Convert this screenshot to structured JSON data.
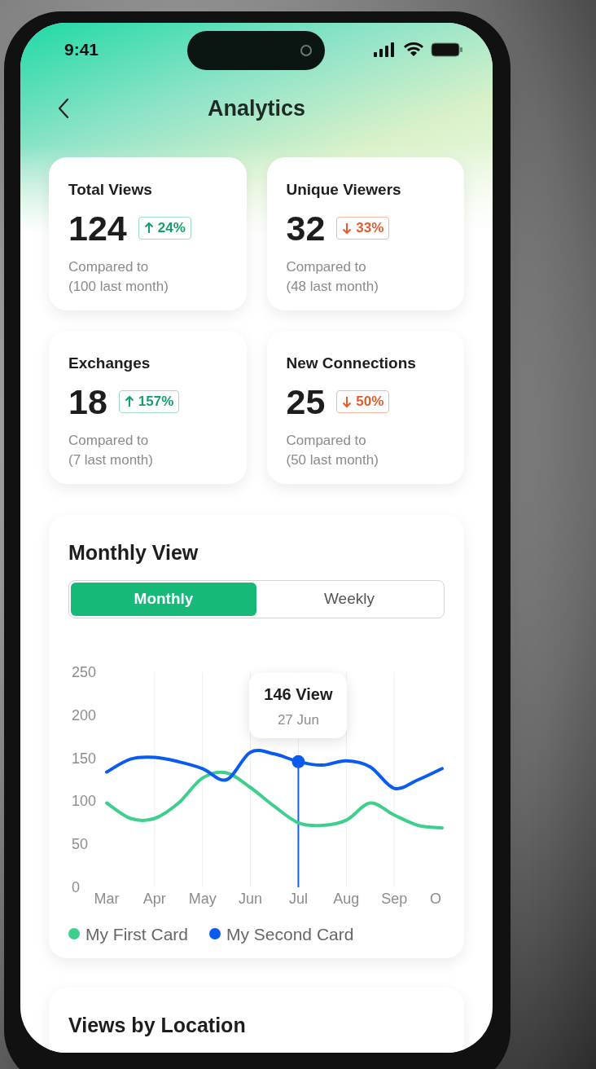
{
  "status_bar": {
    "time": "9:41"
  },
  "header": {
    "title": "Analytics"
  },
  "stats": [
    {
      "label": "Total Views",
      "value": "124",
      "change": "24%",
      "kind": "up",
      "note": "Compared to\n(100 last month)"
    },
    {
      "label": "Unique Viewers",
      "value": "32",
      "change": "33%",
      "kind": "down",
      "note": "Compared to\n(48 last month)"
    },
    {
      "label": "Exchanges",
      "value": "18",
      "change": "157%",
      "kind": "up",
      "note": "Compared to\n(7 last month)"
    },
    {
      "label": "New Connections",
      "value": "25",
      "change": "50%",
      "kind": "down",
      "note": "Compared to\n(50 last month)"
    }
  ],
  "monthly_view": {
    "title": "Monthly View",
    "toggle": [
      {
        "label": "Monthly",
        "selected": true
      },
      {
        "label": "Weekly",
        "selected": false
      }
    ],
    "tooltip": {
      "date": "27 Jun"
    },
    "chart_data": {
      "type": "line",
      "categories": [
        "Mar",
        null,
        "Apr",
        null,
        "May",
        null,
        "Jun",
        null,
        "Jul",
        null,
        "Aug",
        null,
        "Sep",
        null,
        "O"
      ],
      "series": [
        {
          "name": "My First Card",
          "color": "#3ecf8e",
          "values": [
            98,
            80,
            80,
            98,
            127,
            133,
            116,
            94,
            75,
            72,
            78,
            98,
            84,
            72,
            69
          ]
        },
        {
          "name": "My Second Card",
          "color": "#0a5cf0",
          "values": [
            134,
            149,
            151,
            146,
            138,
            125,
            157,
            155,
            146,
            142,
            147,
            140,
            115,
            125,
            138
          ]
        }
      ],
      "ylim": [
        0,
        250
      ],
      "yticks": [
        0,
        50,
        100,
        150,
        200,
        250
      ],
      "grid": true,
      "ref_lines": [
        {
          "axis": "x",
          "value": "Jul"
        }
      ],
      "annotations": [
        "146 View"
      ]
    }
  },
  "location": {
    "title": "Views by Location"
  }
}
